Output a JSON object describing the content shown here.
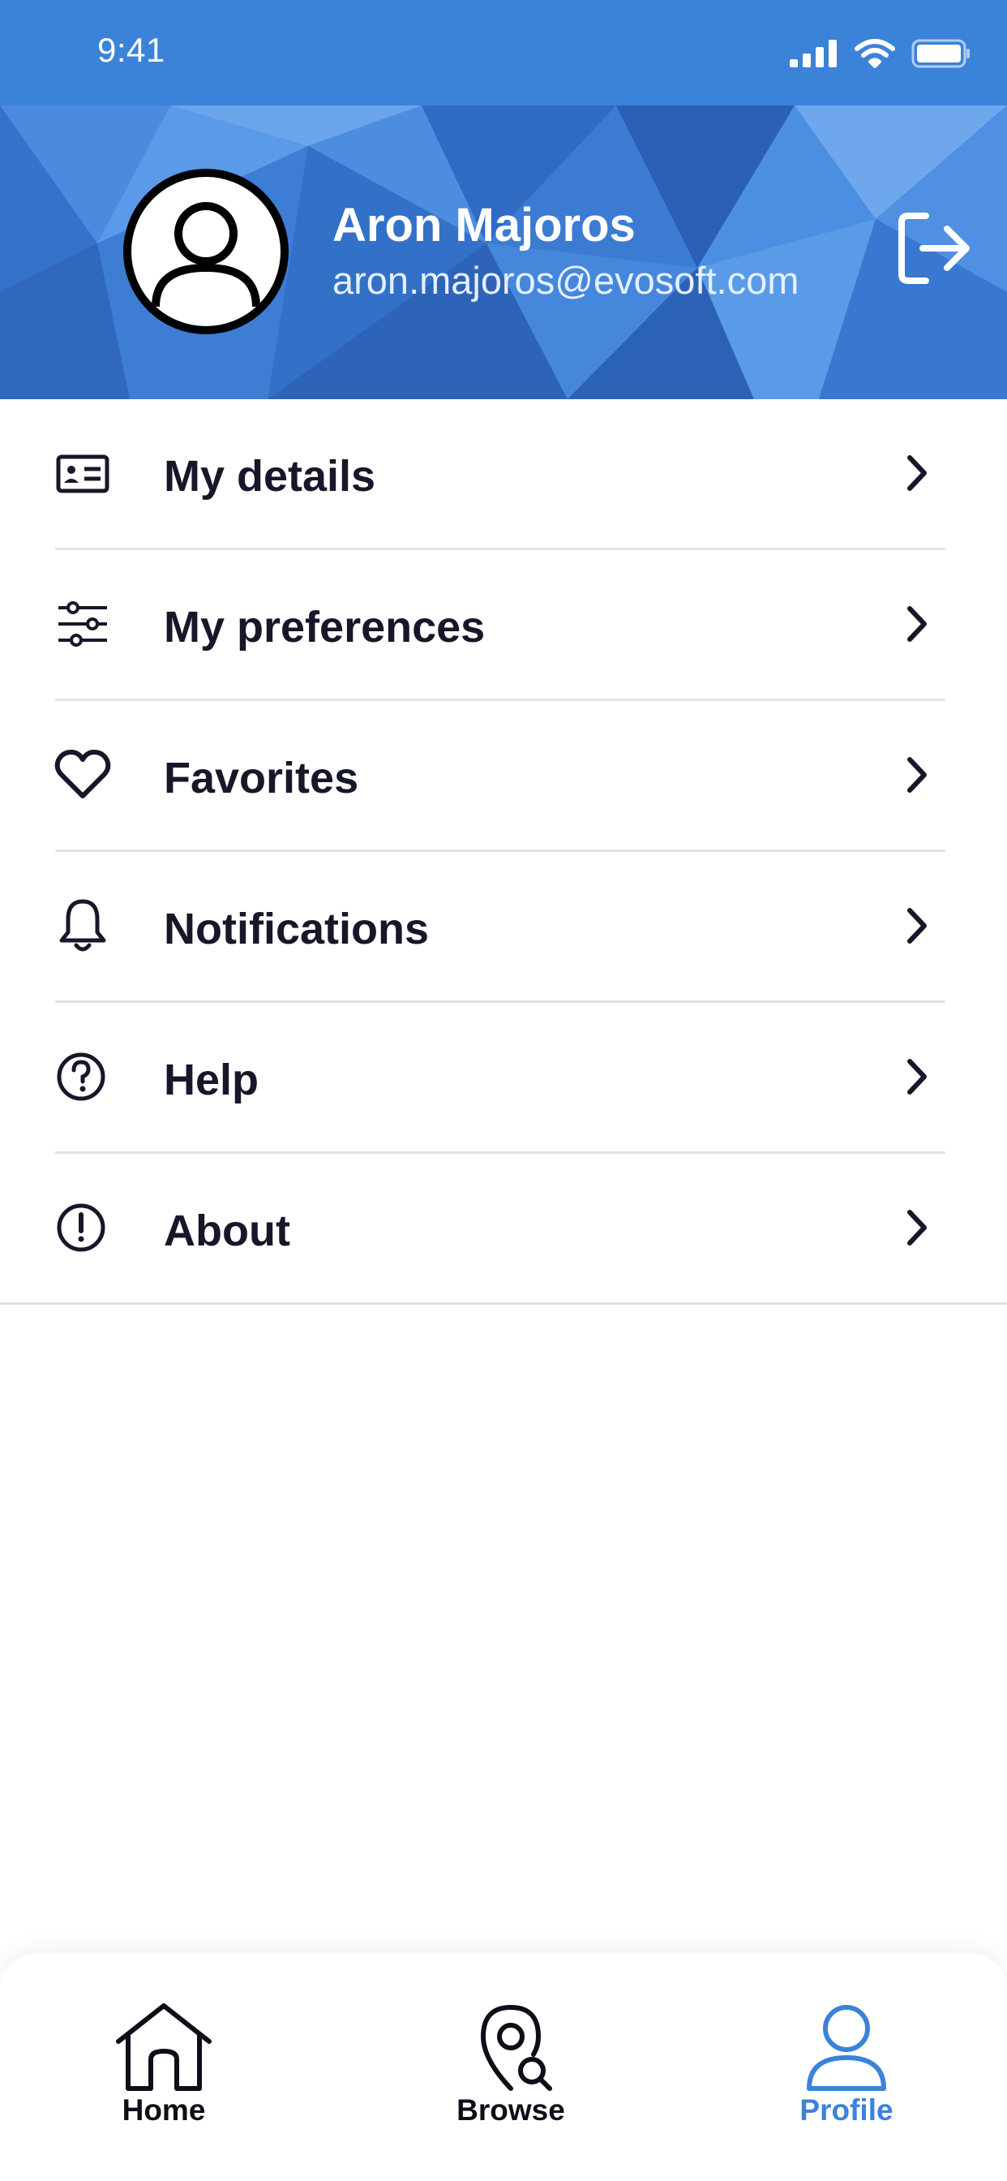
{
  "status_bar": {
    "time": "9:41"
  },
  "profile": {
    "name": "Aron Majoros",
    "email": "aron.majoros@evosoft.com"
  },
  "menu": {
    "items": [
      {
        "label": "My details",
        "icon": "id-card-icon"
      },
      {
        "label": "My preferences",
        "icon": "sliders-icon"
      },
      {
        "label": "Favorites",
        "icon": "heart-icon"
      },
      {
        "label": "Notifications",
        "icon": "bell-icon"
      },
      {
        "label": "Help",
        "icon": "question-circle-icon"
      },
      {
        "label": "About",
        "icon": "exclamation-circle-icon"
      }
    ]
  },
  "tabbar": {
    "tabs": [
      {
        "label": "Home",
        "icon": "home-icon",
        "active": false
      },
      {
        "label": "Browse",
        "icon": "map-search-icon",
        "active": false
      },
      {
        "label": "Profile",
        "icon": "person-icon",
        "active": true
      }
    ]
  },
  "colors": {
    "accent": "#3b82d9",
    "text": "#17172a",
    "divider": "#e2e2e2"
  }
}
